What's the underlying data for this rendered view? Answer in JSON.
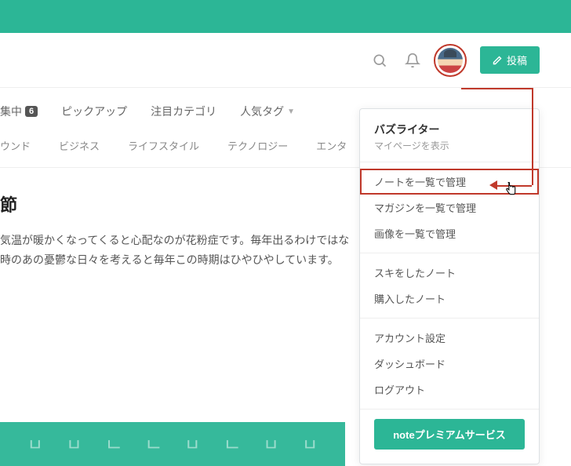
{
  "header": {
    "post_button": "投稿"
  },
  "nav": {
    "item1_label": "集中",
    "item1_badge": "6",
    "item2": "ピックアップ",
    "item3": "注目カテゴリ",
    "item4": "人気タグ"
  },
  "subnav": {
    "c1": "ウンド",
    "c2": "ビジネス",
    "c3": "ライフスタイル",
    "c4": "テクノロジー",
    "c5": "エンタ"
  },
  "article": {
    "title": "節",
    "body1": "気温が暖かくなってくると心配なのが花粉症です。毎年出るわけではな",
    "body2": "時のあの憂鬱な日々を考えると毎年この時期はひやひやしています。"
  },
  "dropdown": {
    "username": "バズライター",
    "mypage": "マイページを表示",
    "g1": {
      "i1": "ノートを一覧で管理",
      "i2": "マガジンを一覧で管理",
      "i3": "画像を一覧で管理"
    },
    "g2": {
      "i1": "スキをしたノート",
      "i2": "購入したノート"
    },
    "g3": {
      "i1": "アカウント設定",
      "i2": "ダッシュボード",
      "i3": "ログアウト"
    },
    "premium": "noteプレミアムサービス"
  },
  "colors": {
    "teal": "#2cb696",
    "highlight": "#c0392b"
  }
}
